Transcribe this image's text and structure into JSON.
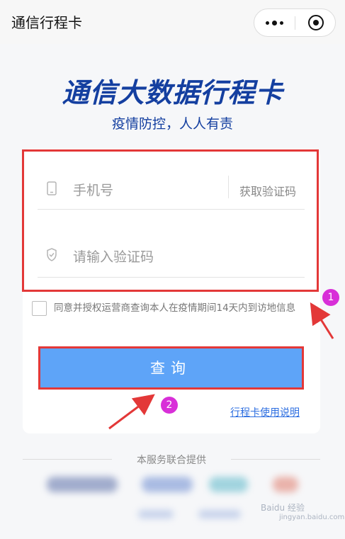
{
  "topbar": {
    "app_title": "通信行程卡",
    "more_icon": "ellipsis-icon",
    "close_icon": "target-close-icon"
  },
  "hero": {
    "title": "通信大数据行程卡",
    "subtitle": "疫情防控，人人有责"
  },
  "form": {
    "phone_placeholder": "手机号",
    "phone_icon": "phone-icon",
    "get_code_label": "获取验证码",
    "code_placeholder": "请输入验证码",
    "code_icon": "shield-icon",
    "agree_checked": false,
    "agree_text": "同意并授权运营商查询本人在疫情期间14天内到访地信息",
    "submit_label": "查询",
    "help_link": "行程卡使用说明"
  },
  "annotations": {
    "badge1": "1",
    "badge2": "2",
    "highlight_color": "#e33838",
    "badge_color": "#d82fd8"
  },
  "footer": {
    "provider_label": "本服务联合提供"
  },
  "watermark": {
    "brand": "Baidu 经验",
    "url": "jingyan.baidu.com"
  },
  "colors": {
    "title_blue": "#143fa0",
    "button_blue": "#5ea4f8",
    "link_blue": "#2b6de0"
  }
}
